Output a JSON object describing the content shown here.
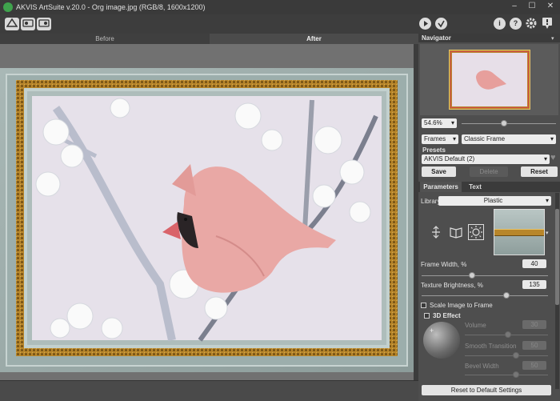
{
  "window": {
    "title": "AKVIS ArtSuite v.20.0 - Org image.jpg (RGB/8, 1600x1200)",
    "controls": [
      "–",
      "☐",
      "✕"
    ]
  },
  "toolbar": {
    "help_label": "?"
  },
  "tabs": {
    "before": "Before",
    "after": "After"
  },
  "navigator": {
    "title": "Navigator",
    "zoom": "54.6%",
    "zoom_level_fraction": 0.45
  },
  "effect": {
    "category": "Frames",
    "type": "Classic Frame"
  },
  "presets": {
    "title": "Presets",
    "current": "AKVIS Default (2)",
    "save": "Save",
    "delete": "Delete",
    "reset": "Reset"
  },
  "settings_tabs": {
    "parameters": "Parameters",
    "text": "Text"
  },
  "params": {
    "library_label": "Library",
    "library_value": "Plastic",
    "frame_width_label": "Frame Width, %",
    "frame_width": "40",
    "frame_width_fraction": 0.4,
    "texture_brightness_label": "Texture Brightness, %",
    "texture_brightness": "135",
    "texture_brightness_fraction": 0.67,
    "scale_label": "Scale Image to Frame",
    "effect3d_label": "3D Effect",
    "volume_label": "Volume",
    "volume": "30",
    "smooth_label": "Smooth Transition",
    "smooth": "50",
    "bevel_label": "Bevel Width",
    "bevel": "50",
    "reset_defaults": "Reset to Default Settings"
  },
  "colors": {
    "gold": "#b8862a",
    "panel": "#4e4e4e",
    "header": "#3b3b3b"
  }
}
